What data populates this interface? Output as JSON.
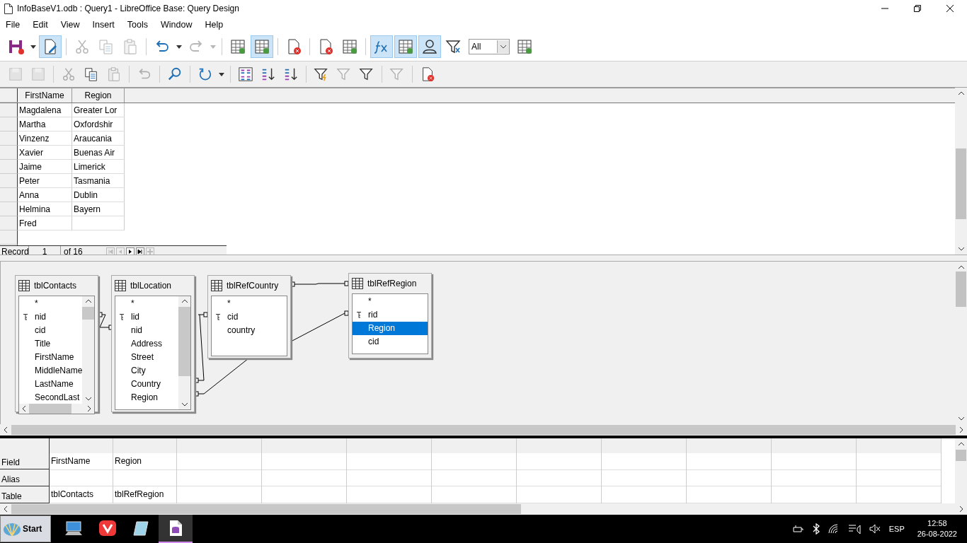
{
  "window": {
    "title": "InfoBaseV1.odb : Query1 - LibreOffice Base: Query Design"
  },
  "menu": [
    "File",
    "Edit",
    "View",
    "Insert",
    "Tools",
    "Window",
    "Help"
  ],
  "toolbar": [
    {
      "kind": "save",
      "on": false,
      "disabled": false,
      "dropdown": true
    },
    {
      "kind": "edit",
      "on": true,
      "disabled": false,
      "dropdown": false
    },
    {
      "kind": "sep"
    },
    {
      "kind": "cut",
      "on": false,
      "disabled": true,
      "dropdown": false
    },
    {
      "kind": "copy",
      "on": false,
      "disabled": true,
      "dropdown": false
    },
    {
      "kind": "paste",
      "on": false,
      "disabled": true,
      "dropdown": false
    },
    {
      "kind": "sep"
    },
    {
      "kind": "undo",
      "on": false,
      "disabled": false,
      "dropdown": true
    },
    {
      "kind": "redo",
      "on": false,
      "disabled": true,
      "dropdown": true
    },
    {
      "kind": "sep"
    },
    {
      "kind": "runquery",
      "on": false,
      "disabled": false,
      "dropdown": false
    },
    {
      "kind": "designview",
      "on": true,
      "disabled": false,
      "dropdown": false
    },
    {
      "kind": "sep"
    },
    {
      "kind": "clearquery",
      "on": false,
      "disabled": false,
      "dropdown": false
    },
    {
      "kind": "sep"
    },
    {
      "kind": "closedoc",
      "on": false,
      "disabled": false,
      "dropdown": false
    },
    {
      "kind": "addtable",
      "on": false,
      "disabled": false,
      "dropdown": false
    },
    {
      "kind": "sep"
    },
    {
      "kind": "functions",
      "on": true,
      "disabled": false,
      "dropdown": false
    },
    {
      "kind": "tablename",
      "on": true,
      "disabled": false,
      "dropdown": false
    },
    {
      "kind": "alias",
      "on": true,
      "disabled": false,
      "dropdown": false
    },
    {
      "kind": "distinct",
      "on": false,
      "disabled": false,
      "dropdown": false
    },
    {
      "kind": "limit",
      "value": "All"
    },
    {
      "kind": "sqlview",
      "on": false,
      "disabled": false,
      "dropdown": false
    }
  ],
  "toolbar2": [
    {
      "kind": "saverecord",
      "disabled": true,
      "dropdown": false
    },
    {
      "kind": "editdata",
      "disabled": true,
      "dropdown": false
    },
    {
      "kind": "sep"
    },
    {
      "kind": "cut",
      "disabled": true,
      "dropdown": false
    },
    {
      "kind": "copy",
      "disabled": false,
      "dropdown": false
    },
    {
      "kind": "paste",
      "disabled": true,
      "dropdown": false
    },
    {
      "kind": "sep"
    },
    {
      "kind": "undo",
      "disabled": true,
      "dropdown": false
    },
    {
      "kind": "sep"
    },
    {
      "kind": "find",
      "disabled": false,
      "dropdown": false
    },
    {
      "kind": "sep"
    },
    {
      "kind": "refresh",
      "disabled": false,
      "dropdown": true
    },
    {
      "kind": "sep"
    },
    {
      "kind": "sort",
      "disabled": false,
      "dropdown": false
    },
    {
      "kind": "sortasc",
      "disabled": false,
      "dropdown": false
    },
    {
      "kind": "sortdesc",
      "disabled": false,
      "dropdown": false
    },
    {
      "kind": "sep"
    },
    {
      "kind": "autofilter",
      "disabled": false,
      "dropdown": false
    },
    {
      "kind": "applyfilter",
      "disabled": true,
      "dropdown": false
    },
    {
      "kind": "stdfilter",
      "disabled": false,
      "dropdown": false
    },
    {
      "kind": "sep"
    },
    {
      "kind": "removefilter",
      "disabled": true,
      "dropdown": false
    },
    {
      "kind": "sep"
    },
    {
      "kind": "closedoc",
      "disabled": false,
      "dropdown": false
    }
  ],
  "results": {
    "columns": [
      "FirstName",
      "Region"
    ],
    "rows": [
      [
        "Magdalena",
        "Greater Lor"
      ],
      [
        "Martha",
        "Oxfordshir"
      ],
      [
        "Vinzenz",
        "Araucania"
      ],
      [
        "Xavier",
        "Buenas Air"
      ],
      [
        "Jaime",
        "Limerick"
      ],
      [
        "Peter",
        "Tasmania"
      ],
      [
        "Anna",
        "Dublin"
      ],
      [
        "Helmina",
        "Bayern"
      ],
      [
        "Fred",
        ""
      ]
    ],
    "record_label": "Record",
    "record_number": "1",
    "record_total": "of 16"
  },
  "design_tables": [
    {
      "name": "tblContacts",
      "hscroll": true,
      "fields": [
        {
          "name": "*",
          "key": false,
          "selected": false
        },
        {
          "name": "nid",
          "key": true,
          "selected": false
        },
        {
          "name": "cid",
          "key": false,
          "selected": false
        },
        {
          "name": "Title",
          "key": false,
          "selected": false
        },
        {
          "name": "FirstName",
          "key": false,
          "selected": false
        },
        {
          "name": "MiddleName",
          "key": false,
          "selected": false
        },
        {
          "name": "LastName",
          "key": false,
          "selected": false
        },
        {
          "name": "SecondLast",
          "key": false,
          "selected": false
        }
      ]
    },
    {
      "name": "tblLocation",
      "hscroll": false,
      "fields": [
        {
          "name": "*",
          "key": false,
          "selected": false
        },
        {
          "name": "lid",
          "key": true,
          "selected": false
        },
        {
          "name": "nid",
          "key": false,
          "selected": false
        },
        {
          "name": "Address",
          "key": false,
          "selected": false
        },
        {
          "name": "Street",
          "key": false,
          "selected": false
        },
        {
          "name": "City",
          "key": false,
          "selected": false
        },
        {
          "name": "Country",
          "key": false,
          "selected": false
        },
        {
          "name": "Region",
          "key": false,
          "selected": false
        }
      ]
    },
    {
      "name": "tblRefCountry",
      "hscroll": false,
      "fields": [
        {
          "name": "*",
          "key": false,
          "selected": false
        },
        {
          "name": "cid",
          "key": true,
          "selected": false
        },
        {
          "name": "country",
          "key": false,
          "selected": false
        }
      ]
    },
    {
      "name": "tblRefRegion",
      "hscroll": false,
      "fields": [
        {
          "name": "*",
          "key": false,
          "selected": false
        },
        {
          "name": "rid",
          "key": true,
          "selected": false
        },
        {
          "name": "Region",
          "key": false,
          "selected": true
        },
        {
          "name": "cid",
          "key": false,
          "selected": false
        }
      ]
    }
  ],
  "criteria": {
    "row_labels": [
      "Field",
      "Alias",
      "Table"
    ],
    "columns": [
      {
        "field": "FirstName",
        "table": "tblContacts"
      },
      {
        "field": "Region",
        "table": "tblRefRegion"
      }
    ]
  },
  "taskbar": {
    "start": "Start",
    "apps": [
      {
        "kind": "computer",
        "selected": false
      },
      {
        "kind": "browser",
        "selected": false
      },
      {
        "kind": "notepad",
        "selected": false
      },
      {
        "kind": "base",
        "selected": true
      }
    ],
    "language": "ESP",
    "time": "12:58",
    "date": "26-08-2022"
  }
}
